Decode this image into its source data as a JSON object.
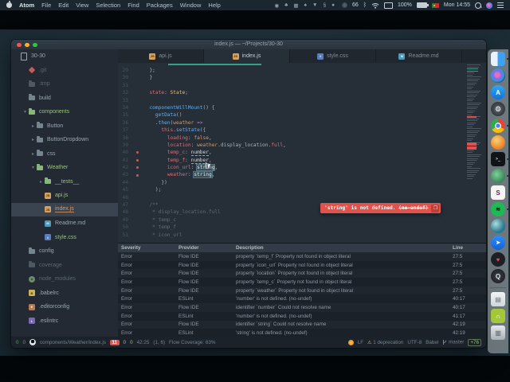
{
  "colors": {
    "accent_red": "#e05252",
    "accent_green": "#98c379",
    "accent_orange": "#d19a66",
    "find_teal": "#35a188"
  },
  "menubar": {
    "items": [
      "Atom",
      "File",
      "Edit",
      "View",
      "Selection",
      "Find",
      "Packages",
      "Window",
      "Help"
    ],
    "extras": [
      "dot-circle",
      "club",
      "grid",
      "spade",
      "triangle-down",
      "section",
      "dot"
    ],
    "status": {
      "counter": "66",
      "battery": "100%",
      "clock": "Mon 14:55"
    }
  },
  "window": {
    "title": "index.js — ~/Projects/30-30"
  },
  "sidebar": {
    "items": [
      {
        "label": "30-30",
        "lvl": 0,
        "icon": "dev",
        "cls": "norm"
      },
      {
        "label": ".git",
        "lvl": 1,
        "icon": "git",
        "cls": "dim"
      },
      {
        "label": ".tmp",
        "lvl": 1,
        "icon": "folder-dim",
        "cls": "dim"
      },
      {
        "label": "build",
        "lvl": 1,
        "icon": "folder",
        "cls": "norm"
      },
      {
        "label": "components",
        "lvl": 1,
        "icon": "folder-grn",
        "cls": "green",
        "chev": "v"
      },
      {
        "label": "Button",
        "lvl": 2,
        "icon": "folder",
        "cls": "norm",
        "chev": ">"
      },
      {
        "label": "ButtonDropdown",
        "lvl": 2,
        "icon": "folder",
        "cls": "norm",
        "chev": ">"
      },
      {
        "label": "css",
        "lvl": 2,
        "icon": "folder",
        "cls": "norm",
        "chev": ">"
      },
      {
        "label": "Weather",
        "lvl": 2,
        "icon": "folder-grn",
        "cls": "green",
        "chev": "v"
      },
      {
        "label": "__tests__",
        "lvl": 3,
        "icon": "folder-grn",
        "cls": "green",
        "chev": ">"
      },
      {
        "label": "api.js",
        "lvl": 3,
        "icon": "js",
        "cls": "green"
      },
      {
        "label": "index.js",
        "lvl": 3,
        "icon": "js",
        "cls": "mod",
        "sel": true
      },
      {
        "label": "Readme.md",
        "lvl": 3,
        "icon": "md",
        "cls": "norm"
      },
      {
        "label": "style.css",
        "lvl": 3,
        "icon": "css",
        "cls": "green"
      },
      {
        "label": "config",
        "lvl": 1,
        "icon": "folder",
        "cls": "norm"
      },
      {
        "label": "coverage",
        "lvl": 1,
        "icon": "folder-dim",
        "cls": "dim"
      },
      {
        "label": "node_modules",
        "lvl": 1,
        "icon": "npm",
        "cls": "dim"
      },
      {
        "label": ".babelrc",
        "lvl": 1,
        "icon": "babel",
        "cls": "norm"
      },
      {
        "label": ".editorconfig",
        "lvl": 1,
        "icon": "edconf",
        "cls": "norm"
      },
      {
        "label": ".eslintrc",
        "lvl": 1,
        "icon": "eslint",
        "cls": "norm"
      }
    ]
  },
  "tabs": [
    {
      "label": "api.js",
      "icon": "js"
    },
    {
      "label": "index.js",
      "icon": "js",
      "active": true
    },
    {
      "label": "style.css",
      "icon": "css"
    },
    {
      "label": "Readme.md",
      "icon": "md"
    }
  ],
  "editor": {
    "lines": [
      {
        "n": 29,
        "t": [
          [
            "  };",
            "d"
          ]
        ]
      },
      {
        "n": 30,
        "t": [
          [
            "  }",
            "d"
          ]
        ]
      },
      {
        "n": 31,
        "t": []
      },
      {
        "n": 32,
        "t": [
          [
            "  ",
            "d"
          ],
          [
            "state",
            "p"
          ],
          [
            ": ",
            "d"
          ],
          [
            "State",
            "t"
          ],
          [
            ";",
            "d"
          ]
        ]
      },
      {
        "n": 33,
        "t": []
      },
      {
        "n": 34,
        "t": [
          [
            "  ",
            "d"
          ],
          [
            "componentWillMount",
            "f"
          ],
          [
            "() {",
            "d"
          ]
        ]
      },
      {
        "n": 35,
        "t": [
          [
            "    ",
            "d"
          ],
          [
            "getData",
            "f"
          ],
          [
            "()",
            "d"
          ]
        ]
      },
      {
        "n": 36,
        "t": [
          [
            "    .",
            "d"
          ],
          [
            "then",
            "f"
          ],
          [
            "(",
            "d"
          ],
          [
            "weather",
            "c"
          ],
          [
            " ",
            "d"
          ],
          [
            "=>",
            "k"
          ]
        ]
      },
      {
        "n": 37,
        "t": [
          [
            "      ",
            "d"
          ],
          [
            "this",
            "p"
          ],
          [
            ".",
            "d"
          ],
          [
            "setState",
            "f"
          ],
          [
            "({",
            "d"
          ]
        ]
      },
      {
        "n": 38,
        "t": [
          [
            "        ",
            "d"
          ],
          [
            "loading",
            "p"
          ],
          [
            ": ",
            "d"
          ],
          [
            "false",
            "c"
          ],
          [
            ",",
            "d"
          ]
        ]
      },
      {
        "n": 39,
        "t": [
          [
            "        ",
            "d"
          ],
          [
            "location",
            "p"
          ],
          [
            ": ",
            "d"
          ],
          [
            "weather",
            "c"
          ],
          [
            ".display_location.",
            "d"
          ],
          [
            "full",
            "p"
          ],
          [
            ",",
            "d"
          ]
        ]
      },
      {
        "n": 40,
        "err": true,
        "t": [
          [
            "        ",
            "d"
          ],
          [
            "temp_c",
            "p"
          ],
          [
            ": ",
            "d"
          ],
          [
            "number",
            "u"
          ],
          [
            ",",
            "d"
          ]
        ]
      },
      {
        "n": 41,
        "err": true,
        "t": [
          [
            "        ",
            "d"
          ],
          [
            "temp_f",
            "p"
          ],
          [
            ": ",
            "d"
          ],
          [
            "number",
            "u"
          ],
          [
            ",",
            "d"
          ]
        ]
      },
      {
        "n": 42,
        "err": true,
        "t": [
          [
            "        ",
            "d"
          ],
          [
            "icon_url",
            "p"
          ],
          [
            ": ",
            "d"
          ],
          [
            "string",
            "s"
          ],
          [
            ",",
            "d"
          ]
        ]
      },
      {
        "n": 43,
        "err": true,
        "t": [
          [
            "        ",
            "d"
          ],
          [
            "weather",
            "p"
          ],
          [
            ": ",
            "d"
          ],
          [
            "string",
            "s"
          ],
          [
            ",",
            "d"
          ]
        ]
      },
      {
        "n": 44,
        "t": [
          [
            "      })",
            "d"
          ]
        ]
      },
      {
        "n": 45,
        "t": [
          [
            "    );",
            "d"
          ]
        ]
      },
      {
        "n": 46,
        "t": []
      },
      {
        "n": 47,
        "t": [
          [
            "  /**",
            "m"
          ]
        ]
      },
      {
        "n": 48,
        "t": [
          [
            "   * display_location.full",
            "m"
          ]
        ]
      },
      {
        "n": 49,
        "t": [
          [
            "   * temp_c",
            "m"
          ]
        ]
      },
      {
        "n": 50,
        "t": [
          [
            "   * temp_f",
            "m"
          ]
        ]
      },
      {
        "n": 51,
        "t": [
          [
            "   * icon_url",
            "m"
          ]
        ]
      }
    ],
    "tooltip": {
      "message": "'string' is not defined. ",
      "rule": "(no-undef)",
      "copy_button": "❐"
    },
    "minimap": {
      "error_lines": [
        27,
        40,
        41,
        42,
        43
      ],
      "teal_lines": [
        3,
        4
      ]
    }
  },
  "linter": {
    "headers": [
      "Severity",
      "Provider",
      "Description",
      "Line"
    ],
    "rows": [
      {
        "severity": "Error",
        "provider": "Flow IDE",
        "description": "property `temp_f` Property not found in object literal",
        "line": "27:5"
      },
      {
        "severity": "Error",
        "provider": "Flow IDE",
        "description": "property `icon_url` Property not found in object literal",
        "line": "27:5"
      },
      {
        "severity": "Error",
        "provider": "Flow IDE",
        "description": "property `location` Property not found in object literal",
        "line": "27:5"
      },
      {
        "severity": "Error",
        "provider": "Flow IDE",
        "description": "property `temp_c` Property not found in object literal",
        "line": "27:5"
      },
      {
        "severity": "Error",
        "provider": "Flow IDE",
        "description": "property `weather` Property not found in object literal",
        "line": "27:5"
      },
      {
        "severity": "Error",
        "provider": "ESLint",
        "description": "'number' is not defined. (no-undef)",
        "line": "40:17"
      },
      {
        "severity": "Error",
        "provider": "Flow IDE",
        "description": "identifier `number` Could not resolve name",
        "line": "40:17"
      },
      {
        "severity": "Error",
        "provider": "ESLint",
        "description": "'number' is not defined. (no-undef)",
        "line": "41:17"
      },
      {
        "severity": "Error",
        "provider": "Flow IDE",
        "description": "identifier `string` Could not resolve name",
        "line": "42:19"
      },
      {
        "severity": "Error",
        "provider": "ESLint",
        "description": "'string' is not defined. (no-undef)",
        "line": "42:19"
      }
    ]
  },
  "statusbar": {
    "counter_a": "0",
    "counter_b": "0",
    "path": "components/Weather/index.js",
    "errors": "11",
    "warnings": "0",
    "info": "0",
    "cursor_position": "42:25",
    "selection": "(1, 6)",
    "flow_coverage": "Flow Coverage: 63%",
    "line_ending": "LF",
    "deprecations": "1 deprecation",
    "encoding": "UTF-8",
    "grammar": "Babel",
    "branch": "master",
    "diff": "+76"
  },
  "dock": {
    "items": [
      {
        "name": "finder",
        "running": true
      },
      {
        "name": "siri"
      },
      {
        "name": "app-store"
      },
      {
        "name": "system-preferences"
      },
      {
        "name": "chrome",
        "running": true
      },
      {
        "name": "rocket"
      },
      {
        "name": "iterm",
        "running": true
      },
      {
        "name": "evernote",
        "running": true
      },
      {
        "name": "slack"
      },
      {
        "name": "spotify",
        "running": true
      },
      {
        "name": "google-earth"
      },
      {
        "name": "messenger"
      },
      {
        "name": "pocket"
      },
      {
        "name": "quicktime"
      },
      {
        "name": "separator"
      },
      {
        "name": "archive-utility"
      },
      {
        "name": "android-file-transfer"
      },
      {
        "name": "trash"
      }
    ]
  }
}
